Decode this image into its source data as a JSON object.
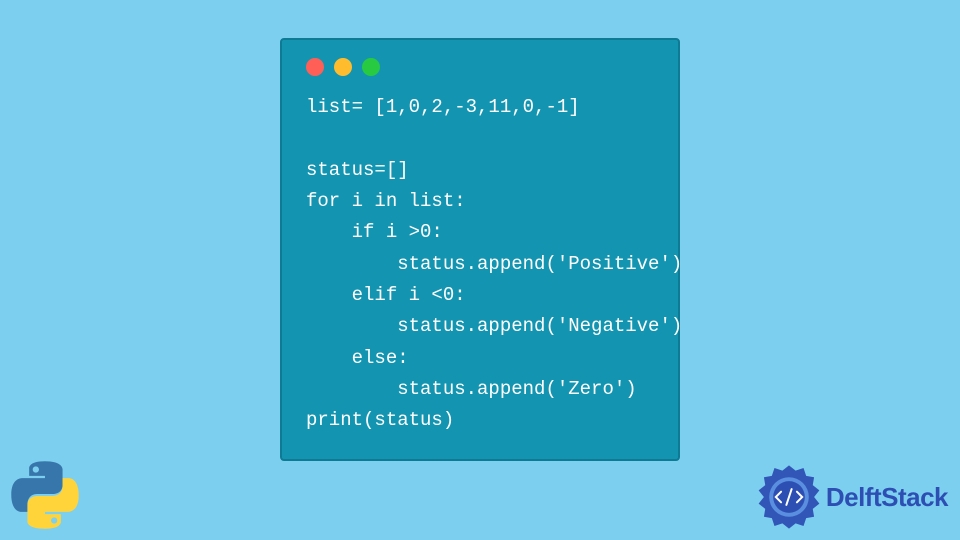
{
  "code": {
    "lines": [
      "list= [1,0,2,-3,11,0,-1]",
      "",
      "status=[]",
      "for i in list:",
      "    if i >0:",
      "        status.append('Positive')",
      "    elif i <0:",
      "        status.append('Negative')",
      "    else:",
      "        status.append('Zero')",
      "print(status)"
    ]
  },
  "window": {
    "dots": [
      "red",
      "yellow",
      "green"
    ]
  },
  "brand": {
    "name": "DelftStack"
  },
  "colors": {
    "page_bg": "#7DCFF0",
    "window_bg": "#1395B2",
    "window_border": "#0F7A93",
    "code_text": "#FFFFFF",
    "brand_blue": "#2D4FB3",
    "python_blue": "#3776AB",
    "python_yellow": "#FFD43B"
  }
}
